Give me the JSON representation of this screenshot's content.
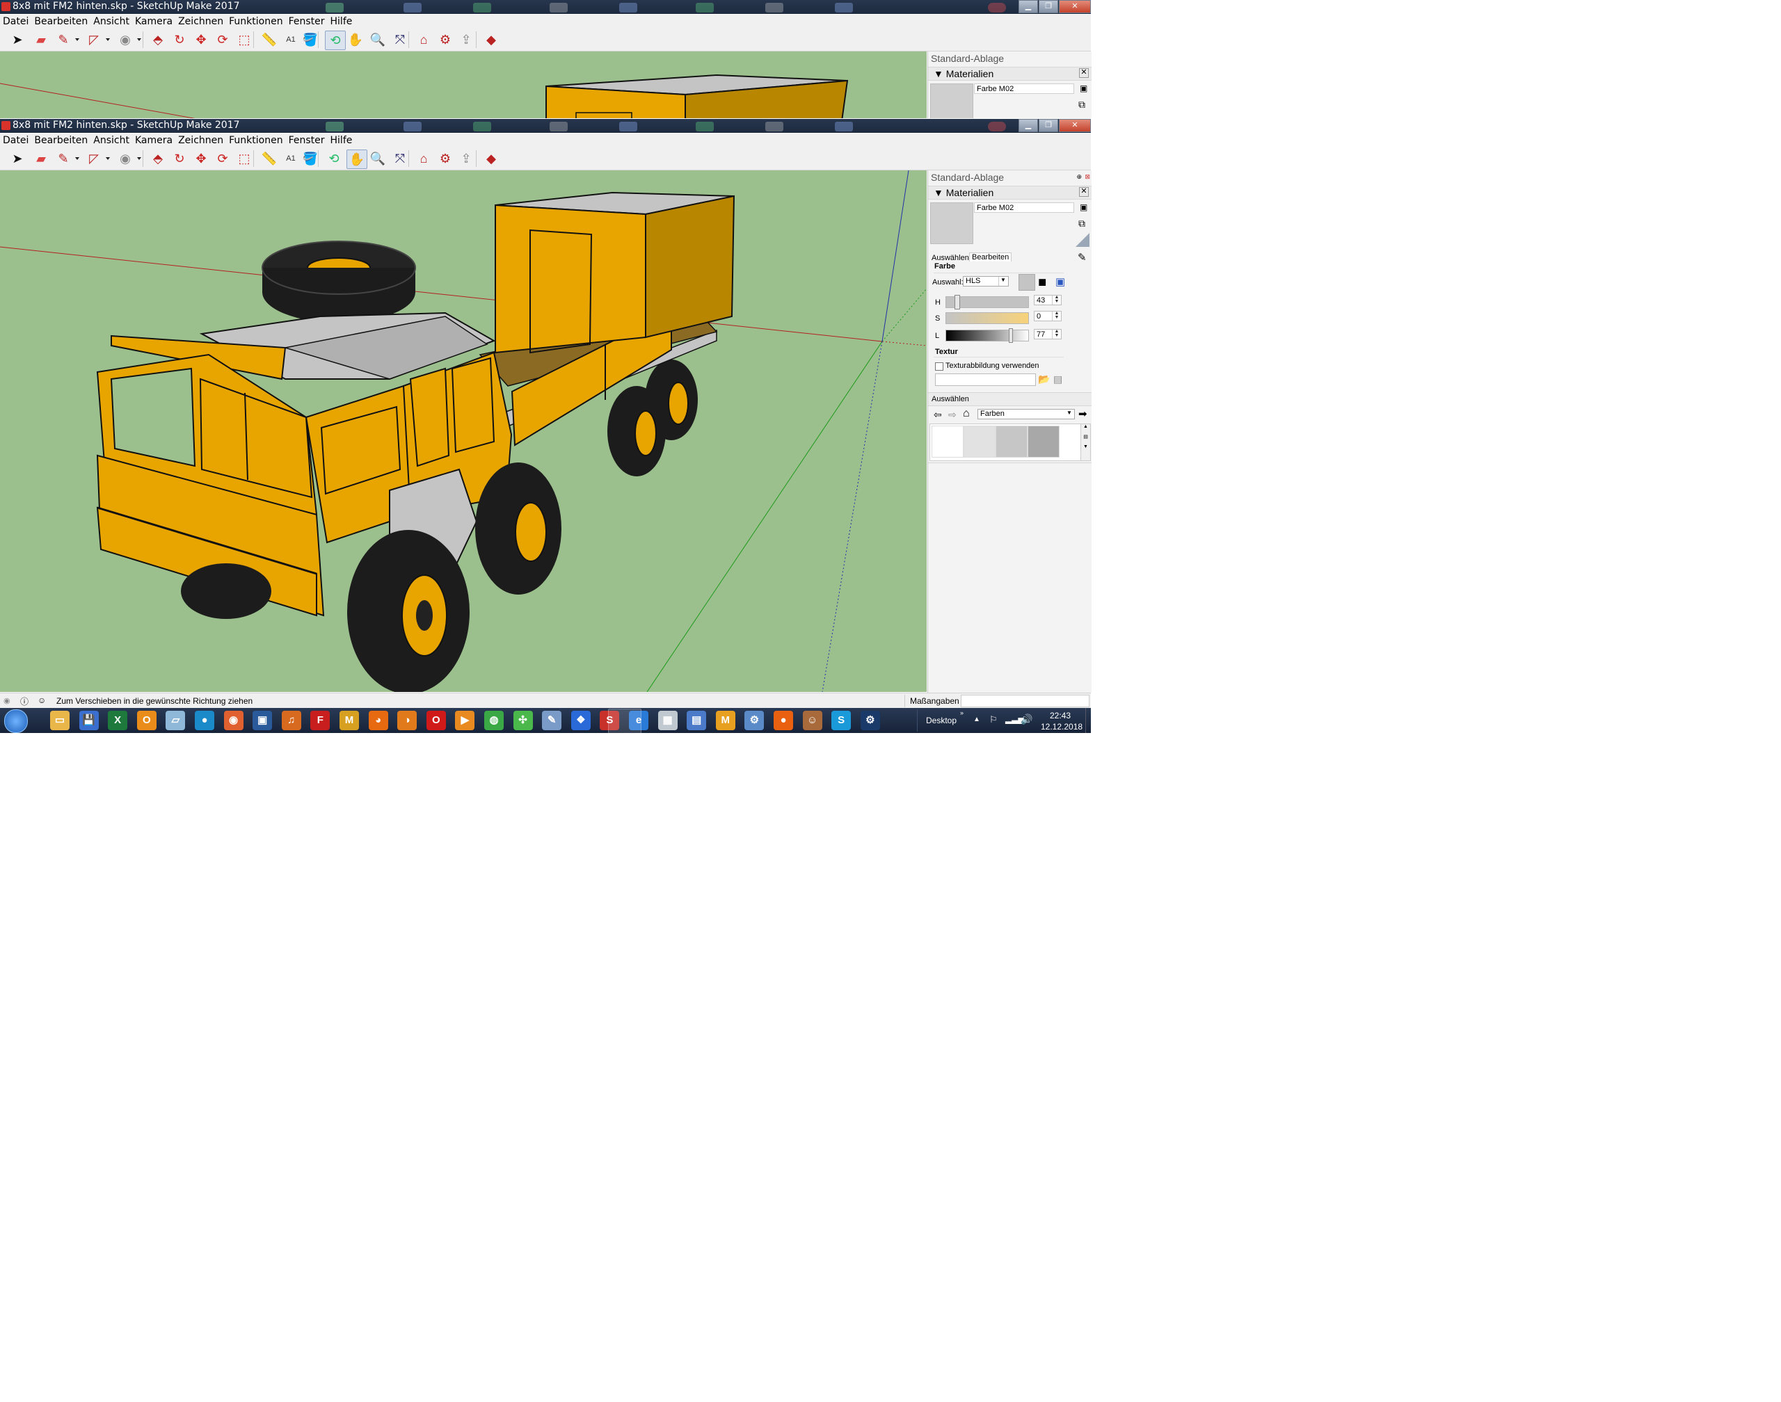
{
  "app": {
    "window_title": "8x8 mit FM2 hinten.skp - SketchUp Make 2017",
    "window_controls": [
      "minimize",
      "restore",
      "close"
    ]
  },
  "menu": [
    "Datei",
    "Bearbeiten",
    "Ansicht",
    "Kamera",
    "Zeichnen",
    "Funktionen",
    "Fenster",
    "Hilfe"
  ],
  "toolbar": {
    "tools": [
      {
        "name": "select-tool-icon",
        "glyph": "➤"
      },
      {
        "name": "eraser-tool-icon",
        "glyph": "▰"
      },
      {
        "name": "line-tool-icon",
        "glyph": "✎"
      },
      {
        "name": "arc-tool-icon",
        "glyph": "◸"
      },
      {
        "name": "shape-tool-icon",
        "glyph": "◉"
      },
      {
        "name": "push-pull-tool-icon",
        "glyph": "⬘"
      },
      {
        "name": "follow-me-tool-icon",
        "glyph": "↻"
      },
      {
        "name": "move-tool-icon",
        "glyph": "✥"
      },
      {
        "name": "rotate-tool-icon",
        "glyph": "⟳"
      },
      {
        "name": "scale-tool-icon",
        "glyph": "⬚"
      },
      {
        "name": "tape-measure-tool-icon",
        "glyph": "📏"
      },
      {
        "name": "text-tool-icon",
        "glyph": "A1"
      },
      {
        "name": "paint-bucket-tool-icon",
        "glyph": "🪣"
      },
      {
        "name": "orbit-tool-icon",
        "glyph": "⟲"
      },
      {
        "name": "pan-tool-icon",
        "glyph": "✋"
      },
      {
        "name": "zoom-tool-icon",
        "glyph": "🔍"
      },
      {
        "name": "zoom-extents-tool-icon",
        "glyph": "⤧"
      },
      {
        "name": "warehouse-icon",
        "glyph": "⌂"
      },
      {
        "name": "extension-warehouse-icon",
        "glyph": "⚙"
      },
      {
        "name": "share-model-icon",
        "glyph": "⇪"
      },
      {
        "name": "ruby-extension-icon",
        "glyph": "◆"
      }
    ]
  },
  "tray": {
    "title": "Standard-Ablage",
    "panel": "Materialien",
    "material_name": "Farbe M02",
    "tabs": [
      "Auswählen",
      "Bearbeiten"
    ],
    "farbe_label": "Farbe",
    "auswahl_label": "Auswahl:",
    "color_model": "HLS",
    "sliders": [
      {
        "label": "H",
        "value": "43"
      },
      {
        "label": "S",
        "value": "0"
      },
      {
        "label": "L",
        "value": "77"
      }
    ],
    "textur_label": "Textur",
    "textur_checkbox": "Texturabbildung verwenden",
    "select_section": "Auswählen",
    "library": "Farben",
    "swatch_colors": [
      "#ffffff",
      "#e2e2e2",
      "#c6c6c6",
      "#a8a8a8"
    ],
    "current_color": "#c4c4c4"
  },
  "status": {
    "hint": "Zum Verschieben in die gewünschte Richtung ziehen",
    "measurements_label": "Maßangaben"
  },
  "taskbar": {
    "apps": [
      "Explorer",
      "Save",
      "Excel",
      "Outlook",
      "Notes",
      "Browser",
      "Viewer",
      "Video",
      "Music",
      "Falk",
      "M",
      "Firefox",
      "Media",
      "Opera",
      "Player",
      "Chrome",
      "Game",
      "Paint",
      "Dropbox",
      "SketchUp",
      "IE",
      "Calculator",
      "Control",
      "Mail",
      "Network",
      "Fox",
      "Avatar",
      "Skype",
      "Steam"
    ],
    "desktop_label": "Desktop",
    "time": "22:43",
    "date": "12.12.2018"
  },
  "colors": {
    "viewport_green": "#9cc08d",
    "truck_yellow": "#e8a500",
    "truck_grey": "#c4c4c4",
    "title_bar": "#1f2d44"
  }
}
